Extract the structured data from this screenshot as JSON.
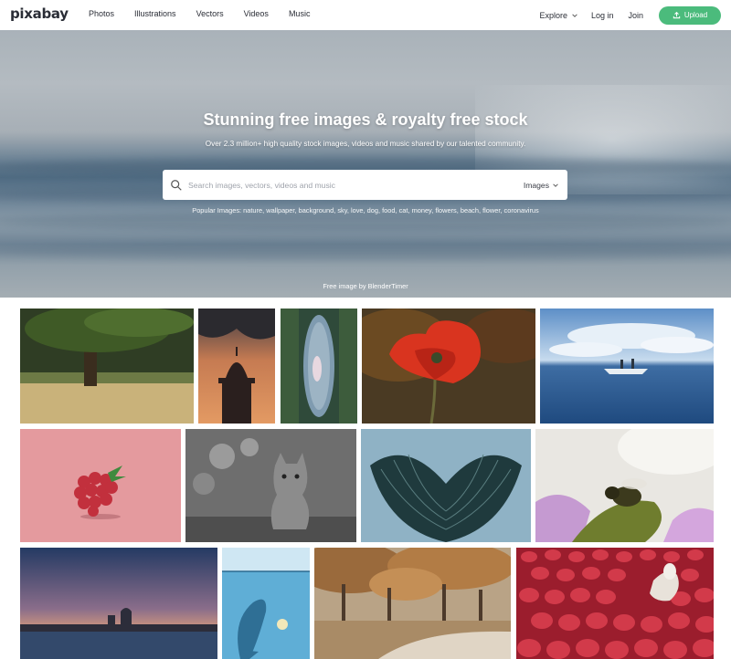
{
  "header": {
    "logo": "pixabay",
    "nav": [
      "Photos",
      "Illustrations",
      "Vectors",
      "Videos",
      "Music"
    ],
    "explore_label": "Explore",
    "login_label": "Log in",
    "join_label": "Join",
    "upload_label": "Upload"
  },
  "hero": {
    "title": "Stunning free images & royalty free stock",
    "subtitle": "Over 2.3 million+ high quality stock images, videos and music shared by our talented community.",
    "search_placeholder": "Search images, vectors, videos and music",
    "search_type": "Images",
    "popular_label": "Popular Images:",
    "popular_tags": [
      "nature",
      "wallpaper",
      "background",
      "sky",
      "love",
      "dog",
      "food",
      "cat",
      "money",
      "flowers",
      "beach",
      "flower",
      "coronavirus"
    ],
    "credit": "Free image by BlenderTimer"
  },
  "colors": {
    "accent": "#4bbb7c"
  }
}
